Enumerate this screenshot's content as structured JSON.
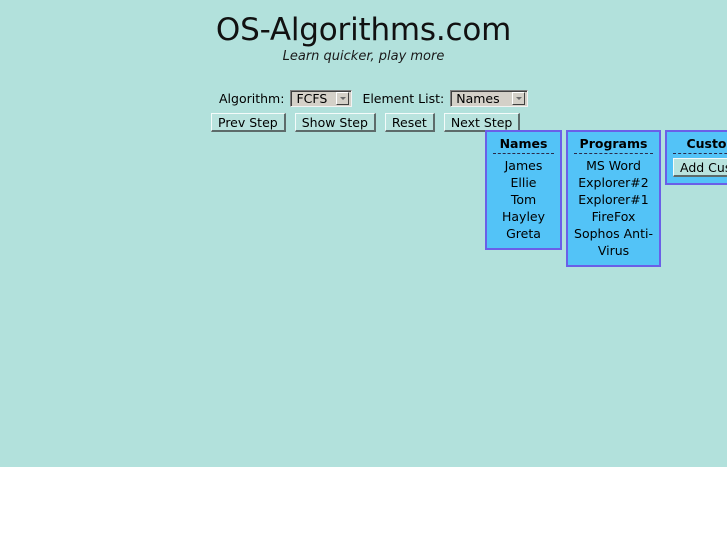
{
  "header": {
    "title": "OS-Algorithms.com",
    "subtitle": "Learn quicker, play more"
  },
  "controls": {
    "algorithm_label": "Algorithm:",
    "algorithm_value": "FCFS",
    "element_list_label": "Element List:",
    "element_list_value": "Names",
    "dropdown_icon": "chevron-down-icon"
  },
  "buttons": [
    {
      "label": "Prev Step"
    },
    {
      "label": "Show Step"
    },
    {
      "label": "Reset"
    },
    {
      "label": "Next Step"
    }
  ],
  "panels": [
    {
      "title": "Names",
      "items": [
        "James",
        "Ellie",
        "Tom",
        "Hayley",
        "Greta"
      ]
    },
    {
      "title": "Programs",
      "items": [
        "MS Word",
        "Explorer#2",
        "Explorer#1",
        "FireFox",
        "Sophos Anti-Virus"
      ]
    },
    {
      "title": "Custom",
      "add_button_label": "Add Custom"
    }
  ],
  "colors": {
    "page_background": "#b2e1dc",
    "panel_fill": "#53c3f7",
    "panel_border": "#6a5fe8",
    "button_face": "#b9e3de",
    "select_face": "#d4d0c8",
    "text": "#000000"
  }
}
